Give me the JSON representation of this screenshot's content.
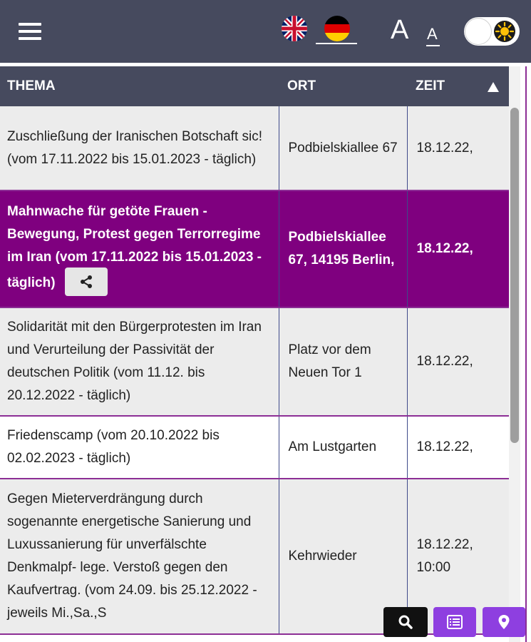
{
  "header": {
    "menu_icon": "hamburger-icon",
    "languages": [
      {
        "code": "en",
        "icon": "uk-flag-icon"
      },
      {
        "code": "de",
        "icon": "germany-flag-icon",
        "active": true
      }
    ],
    "font_size_large_label": "A",
    "font_size_small_label": "A",
    "theme_toggle_icon": "sun-icon"
  },
  "table": {
    "columns": [
      "THEMA",
      "ORT",
      "ZEIT"
    ],
    "sort_icon": "sort-ascending-icon",
    "rows": [
      {
        "thema": "Zuschließung der Iranischen Botschaft sic! (vom 17.11.2022 bis 15.01.2023 - täglich)",
        "ort": "Podbielskiallee 67",
        "zeit": "18.12.22,"
      },
      {
        "thema": "Mahnwache für getöte Frauen - Bewegung, Protest gegen Terrorregime im Iran (vom 17.11.2022 bis 15.01.2023 - täglich)",
        "ort": "Podbielskiallee 67, 14195 Berlin,",
        "zeit": "18.12.22,",
        "highlighted": true,
        "share_icon": "share-icon"
      },
      {
        "thema": "Solidarität mit den Bürgerprotesten im Iran und Verurteilung der Passivität der deutschen Politik (vom 11.12. bis 20.12.2022 - täglich)",
        "ort": "Platz vor dem Neuen Tor 1",
        "zeit": "18.12.22,"
      },
      {
        "thema": "Friedenscamp (vom 20.10.2022 bis 02.02.2023 - täglich)",
        "ort": "Am Lustgarten",
        "zeit": "18.12.22,"
      },
      {
        "thema": "Gegen Mieterverdrängung durch sogenannte energetische Sanierung und Luxussanierung für unverfälschte Denkmalpf- lege. Verstoß gegen den Kaufvertrag. (vom 24.09. bis 25.12.2022 - jeweils Mi.,Sa.,S",
        "ort": "Kehrwieder",
        "zeit": "18.12.22, 10:00"
      }
    ]
  },
  "fab": {
    "search_icon": "search-icon",
    "list_icon": "list-icon",
    "map_icon": "map-pin-icon"
  },
  "colors": {
    "header_bg": "#464a5e",
    "highlight_row": "#7f007f",
    "row_border": "#8c2e95",
    "fab_purple": "#8e3fe0"
  }
}
